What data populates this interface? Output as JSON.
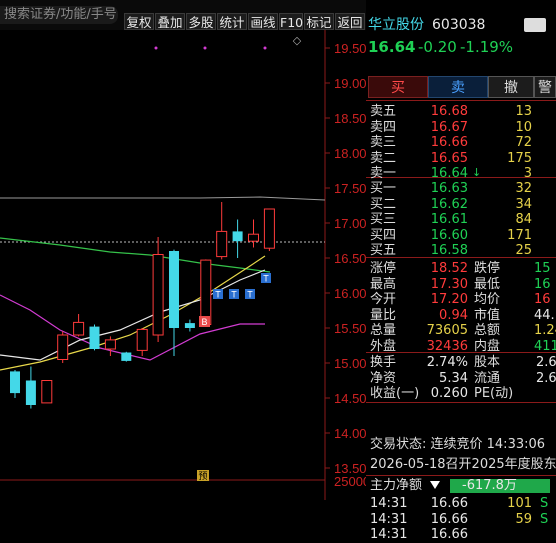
{
  "toolbar": {
    "search_text": "搜索证券/功能/手号",
    "buttons": [
      "复权",
      "叠加",
      "多股",
      "统计",
      "画线",
      "F10",
      "标记",
      "返回"
    ]
  },
  "chart": {
    "price_ticks": [
      "19.50",
      "19.00",
      "18.50",
      "18.00",
      "17.50",
      "17.00",
      "16.50",
      "16.00",
      "15.50",
      "15.00",
      "14.50",
      "14.00",
      "13.50"
    ],
    "volume_tick": "25000",
    "diamond_symbol": "◇",
    "marker_b": "B",
    "marker_t": "T",
    "marker_yu": "预",
    "candles": [
      {
        "o": 14.57,
        "c": 14.88,
        "h": 14.9,
        "l": 14.5,
        "up": false
      },
      {
        "o": 14.75,
        "c": 14.4,
        "h": 14.95,
        "l": 14.35,
        "up": false
      },
      {
        "o": 14.43,
        "c": 14.75,
        "h": 14.75,
        "l": 14.43,
        "up": true
      },
      {
        "o": 15.05,
        "c": 15.4,
        "h": 15.45,
        "l": 15.0,
        "up": true
      },
      {
        "o": 15.4,
        "c": 15.58,
        "h": 15.7,
        "l": 15.38,
        "up": true
      },
      {
        "o": 15.52,
        "c": 15.2,
        "h": 15.55,
        "l": 15.18,
        "up": false
      },
      {
        "o": 15.2,
        "c": 15.33,
        "h": 15.38,
        "l": 15.1,
        "up": true
      },
      {
        "o": 15.15,
        "c": 15.03,
        "h": 15.16,
        "l": 15.02,
        "up": false
      },
      {
        "o": 15.18,
        "c": 15.48,
        "h": 15.5,
        "l": 15.1,
        "up": true
      },
      {
        "o": 15.4,
        "c": 16.55,
        "h": 16.8,
        "l": 15.3,
        "up": true
      },
      {
        "o": 16.6,
        "c": 15.5,
        "h": 16.62,
        "l": 15.1,
        "up": false
      },
      {
        "o": 15.57,
        "c": 15.5,
        "h": 15.62,
        "l": 15.45,
        "up": false
      },
      {
        "o": 15.55,
        "c": 16.47,
        "h": 16.48,
        "l": 15.55,
        "up": true
      },
      {
        "o": 16.52,
        "c": 16.88,
        "h": 17.3,
        "l": 16.48,
        "up": true
      },
      {
        "o": 16.88,
        "c": 16.74,
        "h": 17.05,
        "l": 16.5,
        "up": false
      },
      {
        "o": 16.74,
        "c": 16.84,
        "h": 17.05,
        "l": 16.65,
        "up": true
      },
      {
        "o": 16.64,
        "c": 17.2,
        "h": 17.2,
        "l": 16.6,
        "up": true
      }
    ]
  },
  "panel": {
    "stock_name": "华立股份",
    "stock_code": "603038",
    "price": "16.64",
    "change": "-0.20",
    "change_pct": "-1.19%",
    "actions": [
      "买",
      "卖",
      "撤",
      "警"
    ],
    "asks": [
      {
        "label": "卖五",
        "price": "16.68",
        "vol": "13"
      },
      {
        "label": "卖四",
        "price": "16.67",
        "vol": "10"
      },
      {
        "label": "卖三",
        "price": "16.66",
        "vol": "72"
      },
      {
        "label": "卖二",
        "price": "16.65",
        "vol": "175"
      },
      {
        "label": "卖一",
        "price": "16.64",
        "vol": "3"
      }
    ],
    "bids": [
      {
        "label": "买一",
        "price": "16.63",
        "vol": "32"
      },
      {
        "label": "买二",
        "price": "16.62",
        "vol": "34"
      },
      {
        "label": "买三",
        "price": "16.61",
        "vol": "84"
      },
      {
        "label": "买四",
        "price": "16.60",
        "vol": "171"
      },
      {
        "label": "买五",
        "price": "16.58",
        "vol": "25"
      }
    ],
    "stats": [
      {
        "l1": "涨停",
        "v1": "18.52",
        "l2": "跌停",
        "v2": "15"
      },
      {
        "l1": "最高",
        "v1": "17.30",
        "l2": "最低",
        "v2": "16"
      },
      {
        "l1": "今开",
        "v1": "17.20",
        "l2": "均价",
        "v2": "16"
      },
      {
        "l1": "量比",
        "v1": "0.94",
        "l2": "市值",
        "v2": "44."
      },
      {
        "l1": "总量",
        "v1": "73605",
        "l2": "总额",
        "v2": "1.24"
      },
      {
        "l1": "外盘",
        "v1": "32436",
        "l2": "内盘",
        "v2": "411"
      }
    ],
    "fundamentals": [
      {
        "l1": "换手",
        "v1": "2.74%",
        "l2": "股本",
        "v2": "2.6"
      },
      {
        "l1": "净资",
        "v1": "5.34",
        "l2": "流通",
        "v2": "2.6"
      },
      {
        "l1": "收益(一)",
        "v1": "0.260",
        "l2": "PE(动)",
        "v2": ""
      }
    ],
    "trade_status": "交易状态: 连续竞价 14:33:06",
    "notice": "2026-05-18召开2025年度股东",
    "main_flow_label": "主力净额",
    "main_flow_value": "-617.8万",
    "ticks": [
      {
        "time": "14:31",
        "price": "16.66",
        "vol": "101",
        "side": "S"
      },
      {
        "time": "14:31",
        "price": "16.66",
        "vol": "59",
        "side": "S"
      },
      {
        "time": "14:31",
        "price": "16.66",
        "vol": "",
        "side": ""
      }
    ]
  }
}
